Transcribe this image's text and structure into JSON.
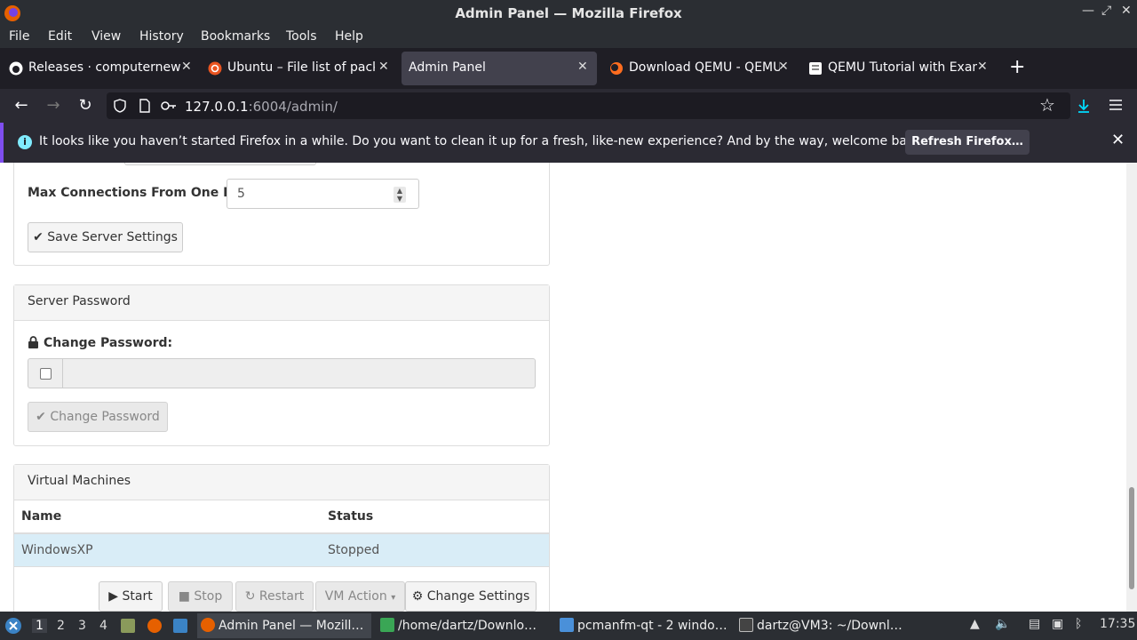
{
  "window": {
    "title": "Admin Panel — Mozilla Firefox",
    "minimize": "—",
    "maximize": "⤢",
    "close": "✕"
  },
  "menu": [
    "File",
    "Edit",
    "View",
    "History",
    "Bookmarks",
    "Tools",
    "Help"
  ],
  "tabs": [
    {
      "title": "Releases · computernewb/c",
      "icon": "github-icon"
    },
    {
      "title": "Ubuntu – File list of packa",
      "icon": "ubuntu-icon"
    },
    {
      "title": "Admin Panel",
      "icon": "",
      "active": true
    },
    {
      "title": "Download QEMU - QEMU",
      "icon": "qemu-icon"
    },
    {
      "title": "QEMU Tutorial with Exam",
      "icon": "page-icon"
    }
  ],
  "tab_close": "✕",
  "new_tab": "+",
  "nav": {
    "url_host": "127.0.0.1",
    "url_rest": ":6004/admin/"
  },
  "notification": {
    "message": "It looks like you haven’t started Firefox in a while. Do you want to clean it up for a fresh, like-new experience? And by the way, welcome back!",
    "button": "Refresh Firefox…",
    "close": "✕"
  },
  "server_settings": {
    "max_conn_label": "Max Connections From One IP:",
    "max_conn_value": "5",
    "save_button": "Save Server Settings"
  },
  "password_panel": {
    "heading": "Server Password",
    "label": "Change Password:",
    "button": "Change Password"
  },
  "vm_panel": {
    "heading": "Virtual Machines",
    "columns": [
      "Name",
      "Status"
    ],
    "rows": [
      {
        "name": "WindowsXP",
        "status": "Stopped"
      }
    ],
    "buttons": {
      "start": "Start",
      "stop": "Stop",
      "restart": "Restart",
      "vm_action": "VM Action",
      "change_settings": "Change Settings"
    }
  },
  "taskbar": {
    "workspaces": [
      "1",
      "2",
      "3",
      "4"
    ],
    "tasks": [
      {
        "label": "Admin Panel — Mozill…",
        "color": "#e66000"
      },
      {
        "label": "/home/dartz/Downlo…",
        "color": "#3aa655"
      },
      {
        "label": "pcmanfm-qt - 2 windo…",
        "color": "#4a90d9"
      },
      {
        "label": "dartz@VM3: ~/Downl…",
        "color": "#444444"
      }
    ],
    "clock": "17:35"
  },
  "colors": {
    "accent": "#7f4eef",
    "row_highlight": "#d9edf7",
    "download_icon": "#0df"
  }
}
